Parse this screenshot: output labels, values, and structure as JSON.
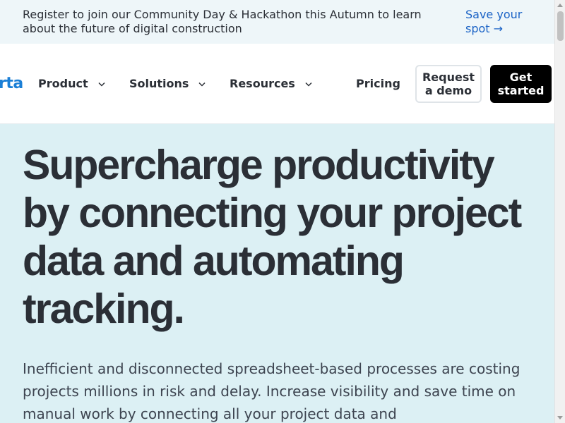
{
  "announcement": {
    "text": "Register to join our Community Day & Hackathon this Autumn to learn about the future of digital construction",
    "link_label": "Save your spot →"
  },
  "header": {
    "logo_text": "rta",
    "nav": {
      "product": "Product",
      "solutions": "Solutions",
      "resources": "Resources",
      "pricing": "Pricing"
    },
    "request_demo_label": "Request a demo",
    "get_started_label": "Get started"
  },
  "hero": {
    "title": "Supercharge productivity by connecting your project data and automating tracking.",
    "subtitle": "Inefficient and disconnected spreadsheet-based processes are costing projects millions in risk and delay. Increase visibility and save time on manual work by connecting all your project data and"
  },
  "icons": {
    "nav_dropdown": "chevron-down-icon"
  },
  "colors": {
    "announcement_bg": "#eef6f9",
    "link": "#1b63c6",
    "hero_bg": "#dcf0f4",
    "primary_button_bg": "#000000",
    "text": "#2b2f36",
    "logo": "#1b7fd6"
  }
}
